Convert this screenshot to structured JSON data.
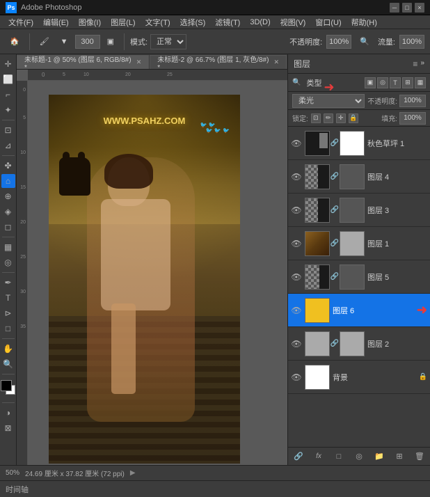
{
  "titlebar": {
    "app_name": "Adobe Photoshop",
    "minimize": "─",
    "maximize": "□",
    "close": "×"
  },
  "menubar": {
    "items": [
      "文件(F)",
      "编辑(E)",
      "图像(I)",
      "图层(L)",
      "文字(T)",
      "选择(S)",
      "滤镜(T)",
      "3D(D)",
      "视图(V)",
      "窗口(U)",
      "帮助(H)"
    ]
  },
  "toolbar": {
    "brush_size": "300",
    "mode_label": "模式:",
    "mode_value": "正常",
    "opacity_label": "不透明度:",
    "opacity_value": "100%",
    "flow_label": "流量:",
    "flow_value": "100%"
  },
  "tabs": [
    {
      "label": "未标题-1 @ 50% (图层 6, RGB/8#) *",
      "active": true
    },
    {
      "label": "未标题-2 @ 66.7% (图层 1, 灰色/8#) *",
      "active": false
    }
  ],
  "canvas": {
    "watermark": "WWW.PSAHZ.COM",
    "zoom": "50%",
    "dimensions": "24.69 厘米 x 37.82 厘米 (72 ppi)"
  },
  "layers_panel": {
    "title": "图层",
    "search_placeholder": "类型",
    "blend_mode": "柔光",
    "opacity_label": "不透明度:",
    "opacity_value": "100%",
    "fill_label": "填充:",
    "fill_value": "100%",
    "lock_label": "锁定:",
    "layers": [
      {
        "name": "秋色草坪 1",
        "visible": true,
        "type": "normal",
        "has_mask": true,
        "is_active": false
      },
      {
        "name": "图层 4",
        "visible": true,
        "type": "normal",
        "has_mask": true,
        "is_active": false
      },
      {
        "name": "图层 3",
        "visible": true,
        "type": "normal",
        "has_mask": true,
        "is_active": false
      },
      {
        "name": "图层 1",
        "visible": true,
        "type": "normal",
        "has_mask": true,
        "is_active": false
      },
      {
        "name": "图层 5",
        "visible": true,
        "type": "normal",
        "has_mask": true,
        "is_active": false
      },
      {
        "name": "图层 6",
        "visible": true,
        "type": "normal",
        "has_mask": false,
        "is_active": true
      },
      {
        "name": "图层 2",
        "visible": true,
        "type": "normal",
        "has_mask": true,
        "is_active": false
      },
      {
        "name": "背景",
        "visible": true,
        "type": "background",
        "has_mask": false,
        "is_active": false
      }
    ],
    "footer_icons": [
      "🔗",
      "fx",
      "□",
      "◉",
      "📁",
      "🗑"
    ]
  },
  "statusbar": {
    "zoom": "50%",
    "dimensions": "24.69 厘米 x 37.82 厘米 (72 ppi)"
  },
  "timeline": {
    "label": "时间轴"
  }
}
